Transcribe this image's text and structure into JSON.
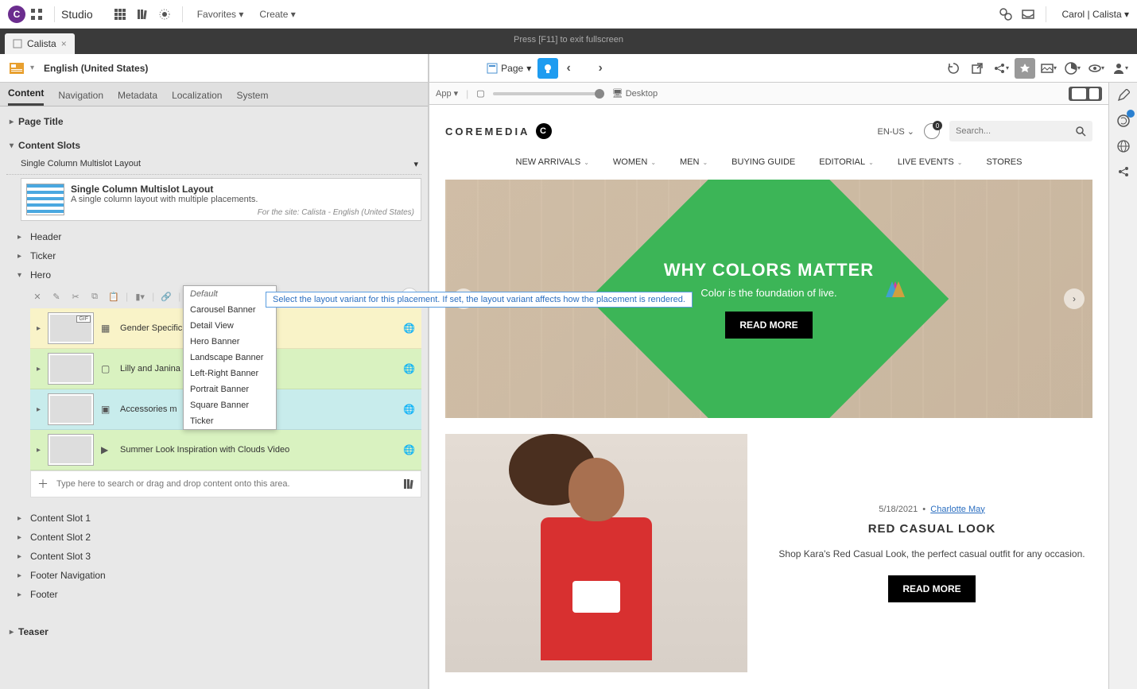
{
  "topbar": {
    "app_title": "Studio",
    "favorites": "Favorites",
    "create": "Create",
    "user": "Carol | Calista"
  },
  "tab": {
    "name": "Calista"
  },
  "fullscreen_hint": "Press [F11] to exit fullscreen",
  "editor": {
    "locale": "English (United States)",
    "page_btn": "Page"
  },
  "lp_tabs": [
    "Content",
    "Navigation",
    "Metadata",
    "Localization",
    "System"
  ],
  "sections": {
    "page_title": "Page Title",
    "content_slots": "Content Slots",
    "teaser": "Teaser"
  },
  "layout": {
    "selector": "Single Column Multislot Layout",
    "title": "Single Column Multislot Layout",
    "desc": "A single column layout with multiple placements.",
    "site": "For the site: Calista - English (United States)"
  },
  "slots": {
    "header": "Header",
    "ticker": "Ticker",
    "hero": "Hero",
    "cs1": "Content Slot 1",
    "cs2": "Content Slot 2",
    "cs3": "Content Slot 3",
    "footer_nav": "Footer Navigation",
    "footer": "Footer"
  },
  "hero": {
    "layout_value": "Hero Banner",
    "tooltip": "Select the layout variant for this placement. If set, the layout variant affects how the placement is rendered.",
    "dropdown": [
      "Default",
      "Carousel Banner",
      "Detail View",
      "Hero Banner",
      "Landscape Banner",
      "Left-Right Banner",
      "Portrait Banner",
      "Square Banner",
      "Ticker"
    ],
    "items": [
      {
        "name": "Gender Specific",
        "color": "yellow",
        "thumb": "th-green",
        "gif": true
      },
      {
        "name": "Lilly and Janina",
        "color": "green",
        "thumb": "th-people"
      },
      {
        "name": "Accessories m",
        "color": "teal",
        "thumb": "th-yellow"
      },
      {
        "name": "Summer Look Inspiration with Clouds Video",
        "color": "green",
        "thumb": "th-sky"
      }
    ],
    "add_placeholder": "Type here to search or drag and drop content onto this area."
  },
  "preview_bar": {
    "mode": "App",
    "device": "Desktop"
  },
  "store": {
    "brand": "COREMEDIA",
    "locale": "EN-US",
    "cart_count": "0",
    "search_placeholder": "Search...",
    "nav": [
      "NEW ARRIVALS",
      "WOMEN",
      "MEN",
      "BUYING GUIDE",
      "EDITORIAL",
      "LIVE EVENTS",
      "STORES"
    ],
    "nav_has_dd": [
      true,
      true,
      true,
      false,
      true,
      true,
      false
    ],
    "hero": {
      "title": "WHY COLORS MATTER",
      "subtitle": "Color is the foundation of live.",
      "cta": "READ MORE"
    },
    "article": {
      "date": "5/18/2021",
      "author": "Charlotte May",
      "title": "RED CASUAL LOOK",
      "desc": "Shop Kara's Red Casual Look, the perfect casual outfit for any occasion.",
      "cta": "READ MORE"
    }
  }
}
